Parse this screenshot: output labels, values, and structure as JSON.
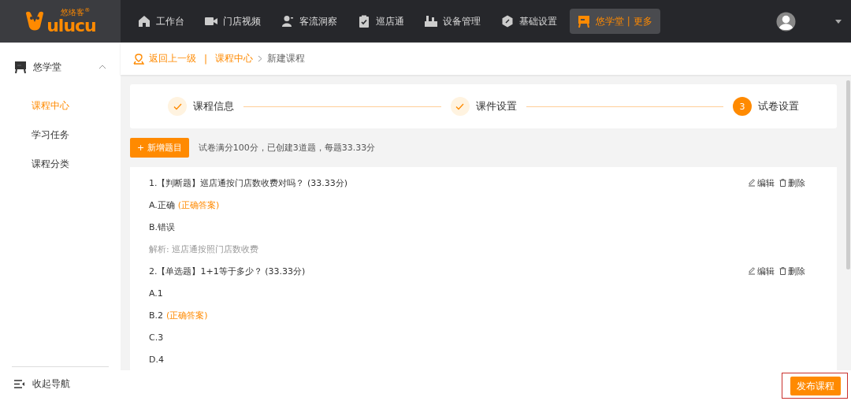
{
  "logo": {
    "wordmark": "ulucu",
    "chinese": "悠络客",
    "registered": "®"
  },
  "top_nav": [
    {
      "label": "工作台",
      "selected": false
    },
    {
      "label": "门店视频",
      "selected": false
    },
    {
      "label": "客流洞察",
      "selected": false
    },
    {
      "label": "巡店通",
      "selected": false
    },
    {
      "label": "设备管理",
      "selected": false
    },
    {
      "label": "基础设置",
      "selected": false
    },
    {
      "label": "悠学堂 | 更多",
      "selected": true
    }
  ],
  "sidebar": {
    "group": {
      "label": "悠学堂",
      "expanded": true,
      "children": [
        {
          "label": "课程中心",
          "selected": true
        },
        {
          "label": "学习任务",
          "selected": false
        },
        {
          "label": "课程分类",
          "selected": false
        }
      ]
    },
    "collapse": "收起导航"
  },
  "breadcrumb": {
    "back": "返回上一级",
    "separator": "|",
    "parent": "课程中心",
    "current": "新建课程"
  },
  "steps": [
    {
      "label": "课程信息",
      "completed": true
    },
    {
      "label": "课件设置",
      "completed": true
    },
    {
      "label": "试卷设置",
      "completed": false,
      "number": "3"
    }
  ],
  "add_button": "+ 新增题目",
  "summary": "试卷满分100分，已创建3道题，每题33.33分",
  "questions": [
    {
      "title": "1.【判断题】巡店通按门店数收费对吗？ (33.33分)",
      "actions": [
        "编辑",
        "删除"
      ],
      "options": [
        {
          "text": "A.正确",
          "answer_tag": "(正确答案)"
        },
        {
          "text": "B.错误"
        }
      ],
      "analysis": "解析: 巡店通按照门店数收费"
    },
    {
      "title": "2.【单选题】1+1等于多少？ (33.33分)",
      "actions": [
        "编辑",
        "删除"
      ],
      "options": [
        {
          "text": "A.1"
        },
        {
          "text": "B.2",
          "answer_tag": "(正确答案)"
        },
        {
          "text": "C.3"
        },
        {
          "text": "D.4"
        }
      ]
    }
  ],
  "publish_button": "发布课程"
}
